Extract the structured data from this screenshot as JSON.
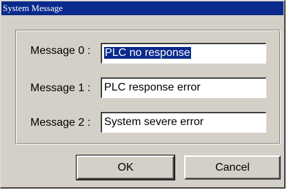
{
  "window": {
    "title": "System Message"
  },
  "messages": [
    {
      "label": "Message 0 :",
      "value": "PLC no response",
      "selected": true
    },
    {
      "label": "Message 1 :",
      "value": "PLC response error",
      "selected": false
    },
    {
      "label": "Message 2 :",
      "value": "System severe error",
      "selected": false
    }
  ],
  "buttons": {
    "ok_label": "OK",
    "cancel_label": "Cancel"
  },
  "colors": {
    "titlebar": "#0a2a8c",
    "face": "#d4d0c8",
    "selection": "#0a2a8c"
  }
}
